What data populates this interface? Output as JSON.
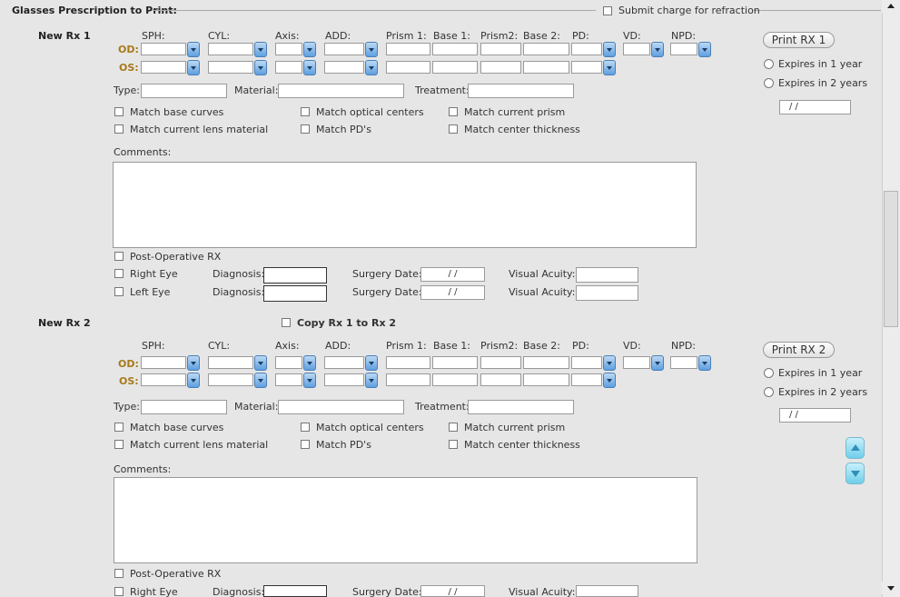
{
  "section": {
    "title": "Glasses Prescription to Print:",
    "submit_charge_label": "Submit charge for refraction"
  },
  "columns": [
    "SPH:",
    "CYL:",
    "Axis:",
    "ADD:",
    "Prism 1:",
    "Base 1:",
    "Prism2:",
    "Base 2:",
    "PD:",
    "VD:",
    "NPD:"
  ],
  "eyes": {
    "od": "OD:",
    "os": "OS:"
  },
  "rx1": {
    "label": "New Rx 1",
    "print_button": "Print RX 1",
    "expires_1": "Expires in 1 year",
    "expires_2": "Expires in 2 years",
    "expire_date": " /  /",
    "type_label": "Type:",
    "material_label": "Material:",
    "treatment_label": "Treatment:",
    "match_base_curves": "Match base curves",
    "match_optical_centers": "Match optical centers",
    "match_current_prism": "Match current prism",
    "match_lens_material": "Match current lens material",
    "match_pds": "Match PD's",
    "match_center_thickness": "Match center thickness",
    "comments_label": "Comments:",
    "post_op": "Post-Operative RX",
    "right_eye": "Right Eye",
    "left_eye": "Left Eye",
    "diagnosis_label": "Diagnosis:",
    "surgery_date_label": "Surgery Date:",
    "surgery_date_value": " /  /",
    "visual_acuity_label": "Visual Acuity:"
  },
  "rx2": {
    "label": "New Rx 2",
    "copy_label": "Copy Rx 1 to Rx 2",
    "print_button": "Print RX 2",
    "expires_1": "Expires in 1 year",
    "expires_2": "Expires in 2 years",
    "expire_date": " /  /",
    "type_label": "Type:",
    "material_label": "Material:",
    "treatment_label": "Treatment:",
    "match_base_curves": "Match base curves",
    "match_optical_centers": "Match optical centers",
    "match_current_prism": "Match current prism",
    "match_lens_material": "Match current lens material",
    "match_pds": "Match PD's",
    "match_center_thickness": "Match center thickness",
    "comments_label": "Comments:",
    "post_op": "Post-Operative RX",
    "right_eye": "Right Eye",
    "diagnosis_label": "Diagnosis:",
    "surgery_date_label": "Surgery Date:",
    "surgery_date_value": " /  /",
    "visual_acuity_label": "Visual Acuity:"
  },
  "icons": {
    "dropdown": "chevron-down-icon",
    "scroll_up": "triangle-up-icon",
    "scroll_down": "triangle-down-icon"
  },
  "colors": {
    "od_os_label": "#a8791a",
    "dropdown_blue": "#5e9fe0",
    "nav_cyan": "#6fcfea"
  }
}
